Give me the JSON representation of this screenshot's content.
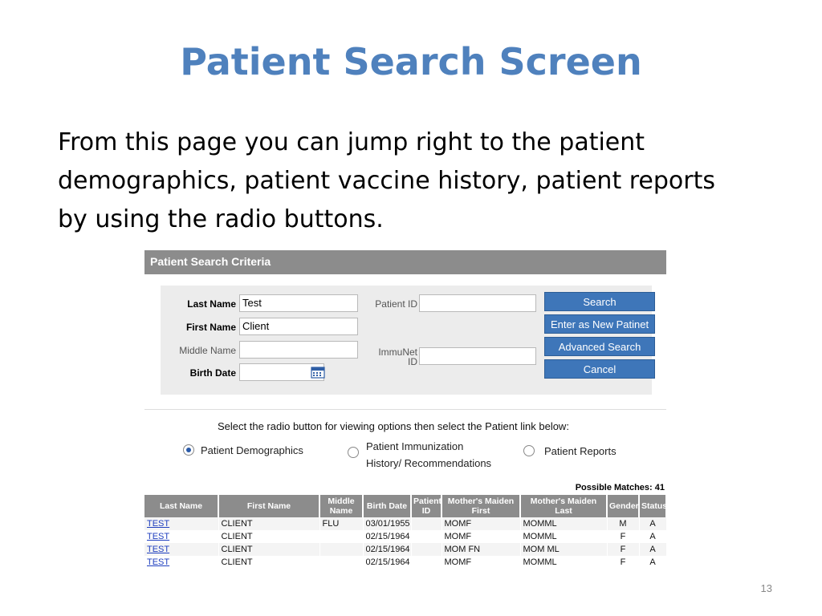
{
  "slide": {
    "title": "Patient Search Screen",
    "body": "From this page you can jump right to the patient demographics, patient vaccine history, patient reports by using the radio buttons.",
    "page_number": "13"
  },
  "criteria": {
    "header": "Patient Search Criteria",
    "last_name_label": "Last Name",
    "last_name_value": "Test",
    "first_name_label": "First Name",
    "first_name_value": "Client",
    "middle_name_label": "Middle Name",
    "middle_name_value": "",
    "birth_date_label": "Birth Date",
    "birth_date_value": "",
    "patient_id_label": "Patient ID",
    "patient_id_value": "",
    "immunet_label_1": "ImmuNet",
    "immunet_label_2": "ID",
    "immunet_value": "",
    "buttons": {
      "search": "Search",
      "new_patient": "Enter as New Patinet",
      "advanced": "Advanced Search",
      "cancel": "Cancel"
    }
  },
  "options": {
    "instruction": "Select the radio button for viewing options then select the Patient link below:",
    "demographics": "Patient Demographics",
    "immunization_1": "Patient Immunization",
    "immunization_2": "History/ Recommendations",
    "reports": "Patient Reports",
    "selected": "demographics"
  },
  "results": {
    "possible_matches": "Possible Matches: 41",
    "columns": [
      "Last Name",
      "First Name",
      "Middle Name",
      "Birth Date",
      "Patient ID",
      "Mother's Maiden First",
      "Mother's Maiden Last",
      "Gender",
      "Status"
    ],
    "rows": [
      [
        "TEST",
        "CLIENT",
        "FLU",
        "03/01/1955",
        "",
        "MOMF",
        "MOMML",
        "M",
        "A"
      ],
      [
        "TEST",
        "CLIENT",
        "",
        "02/15/1964",
        "",
        "MOMF",
        "MOMML",
        "F",
        "A"
      ],
      [
        "TEST",
        "CLIENT",
        "",
        "02/15/1964",
        "",
        "MOM FN",
        "MOM ML",
        "F",
        "A"
      ],
      [
        "TEST",
        "CLIENT",
        "",
        "02/15/1964",
        "",
        "MOMF",
        "MOMML",
        "F",
        "A"
      ]
    ]
  },
  "colors": {
    "title": "#4f81bd",
    "button": "#3e76b9",
    "header_gray": "#8c8c8c"
  }
}
